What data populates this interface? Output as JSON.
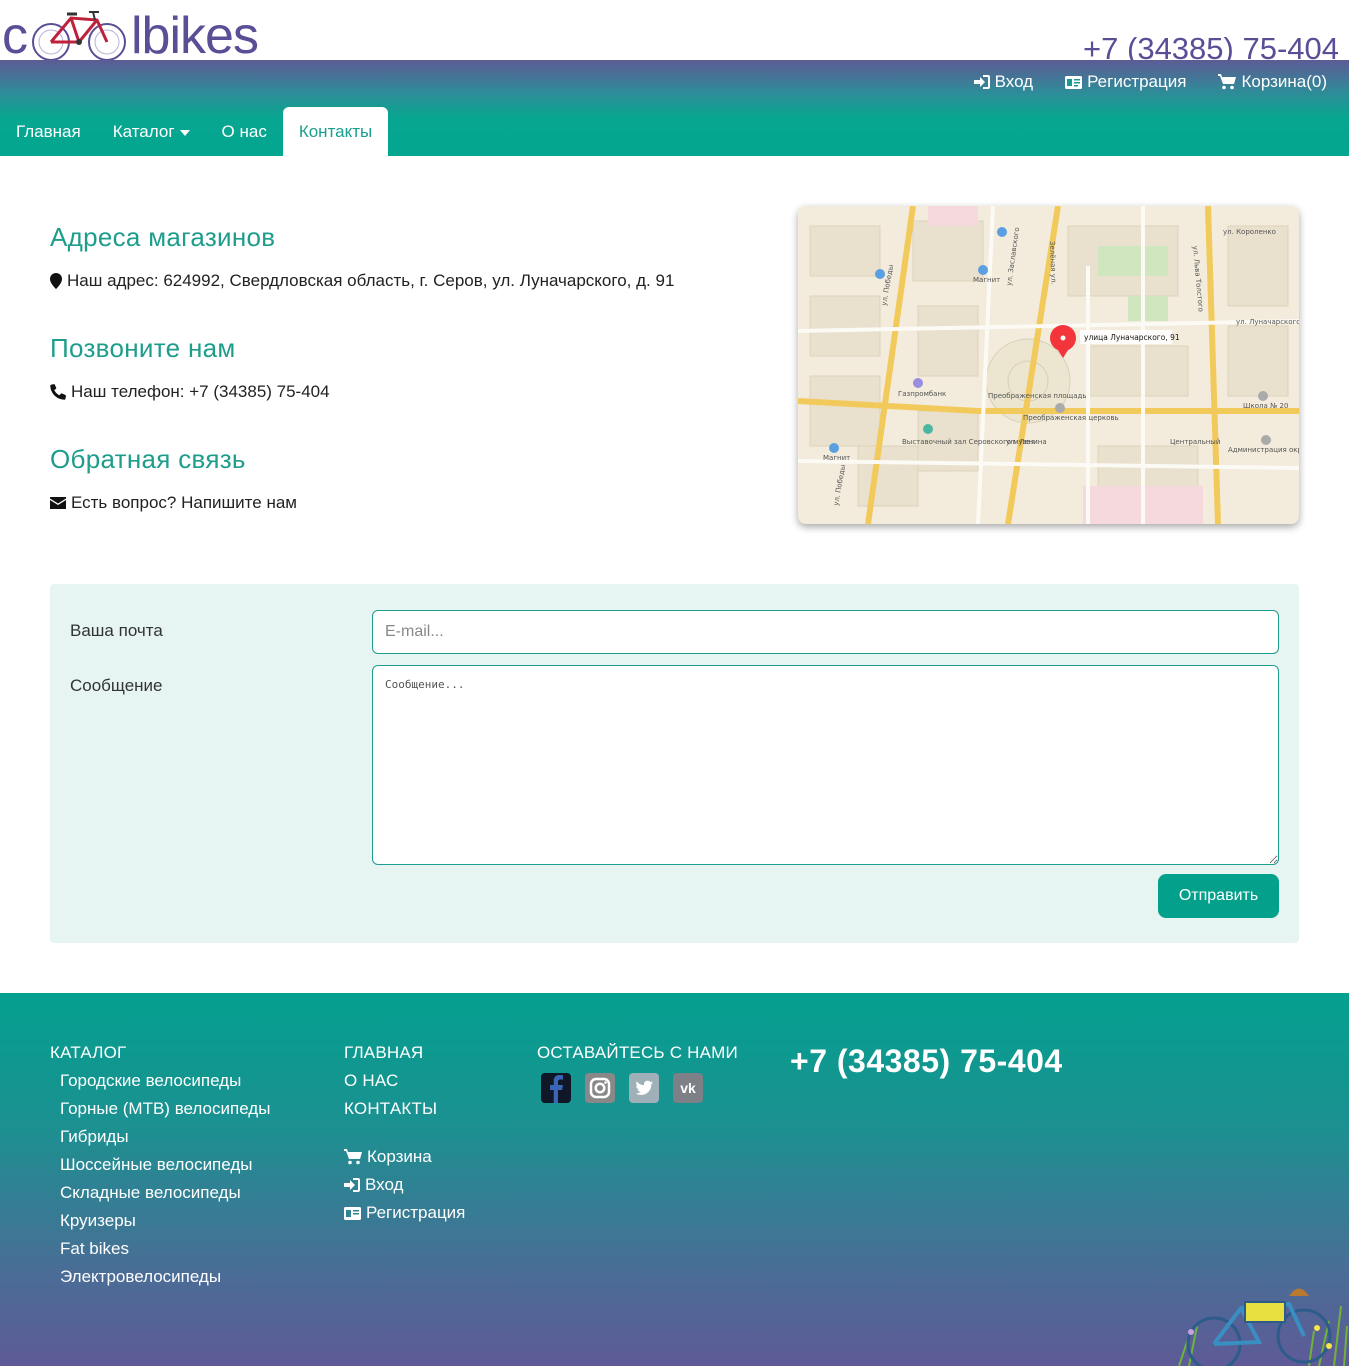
{
  "header": {
    "logo_left": "c",
    "logo_right": "lbikes",
    "phone": "+7 (34385) 75-404",
    "user_links": [
      {
        "label": "Вход",
        "icon": "sign-in-icon"
      },
      {
        "label": "Регистрация",
        "icon": "id-card-icon"
      },
      {
        "label": "Корзина(0)",
        "icon": "cart-icon"
      }
    ],
    "nav": [
      {
        "label": "Главная"
      },
      {
        "label": "Каталог"
      },
      {
        "label": "О нас"
      },
      {
        "label": "Контакты",
        "active": true
      }
    ]
  },
  "contacts": {
    "address_title": "Адреса магазинов",
    "address_text": "Наш адрес: 624992, Свердловская область, г. Серов, ул. Луначарского, д. 91",
    "phone_title": "Позвоните нам",
    "phone_text": "Наш телефон: +7 (34385) 75-404",
    "feedback_title": "Обратная связь",
    "feedback_text": "Есть вопрос? Напишите нам"
  },
  "map": {
    "marker_label": "улица Луначарского, 91",
    "streets": [
      "ул. Победы",
      "ул. Заславского",
      "ул. Льва Толстого",
      "ул. Ленина",
      "ул. Короленко",
      "ул. Луначарского",
      "Зелёная ул.",
      "ул. Победы"
    ],
    "places": [
      "Магнит",
      "Газпромбанк",
      "Преображенская площадь",
      "Преображенская церковь",
      "Выставочный зал Серовского музея",
      "Школа № 20",
      "Администрация округа",
      "Центральный",
      "Магнит"
    ]
  },
  "form": {
    "email_label": "Ваша почта",
    "email_placeholder": "E-mail...",
    "message_label": "Сообщение",
    "message_placeholder": "Сообщение...",
    "submit_label": "Отправить"
  },
  "footer": {
    "catalog_title": "КАТАЛОГ",
    "catalog_items": [
      "Городские велосипеды",
      "Горные (MTB) велосипеды",
      "Гибриды",
      "Шоссейные велосипеды",
      "Складные велосипеды",
      "Круизеры",
      "Fat bikes",
      "Электровелосипеды"
    ],
    "nav_items": [
      "ГЛАВНАЯ",
      "О НАС",
      "КОНТАКТЫ"
    ],
    "account_items": [
      {
        "label": "Корзина",
        "icon": "cart-icon"
      },
      {
        "label": "Вход",
        "icon": "sign-in-icon"
      },
      {
        "label": "Регистрация",
        "icon": "id-card-icon"
      }
    ],
    "social_title": "ОСТАВАЙТЕСЬ С НАМИ",
    "socials": [
      {
        "name": "facebook",
        "color": "#1a1a2e"
      },
      {
        "name": "instagram",
        "color": "#8a8a8a"
      },
      {
        "name": "twitter",
        "color": "#9aa7ad"
      },
      {
        "name": "vk",
        "color": "#7d8187"
      }
    ],
    "phone": "+7 (34385) 75-404"
  },
  "colors": {
    "brand_purple": "#5a4e96",
    "brand_teal": "#03a68f",
    "heading_teal": "#1e9d8c"
  }
}
